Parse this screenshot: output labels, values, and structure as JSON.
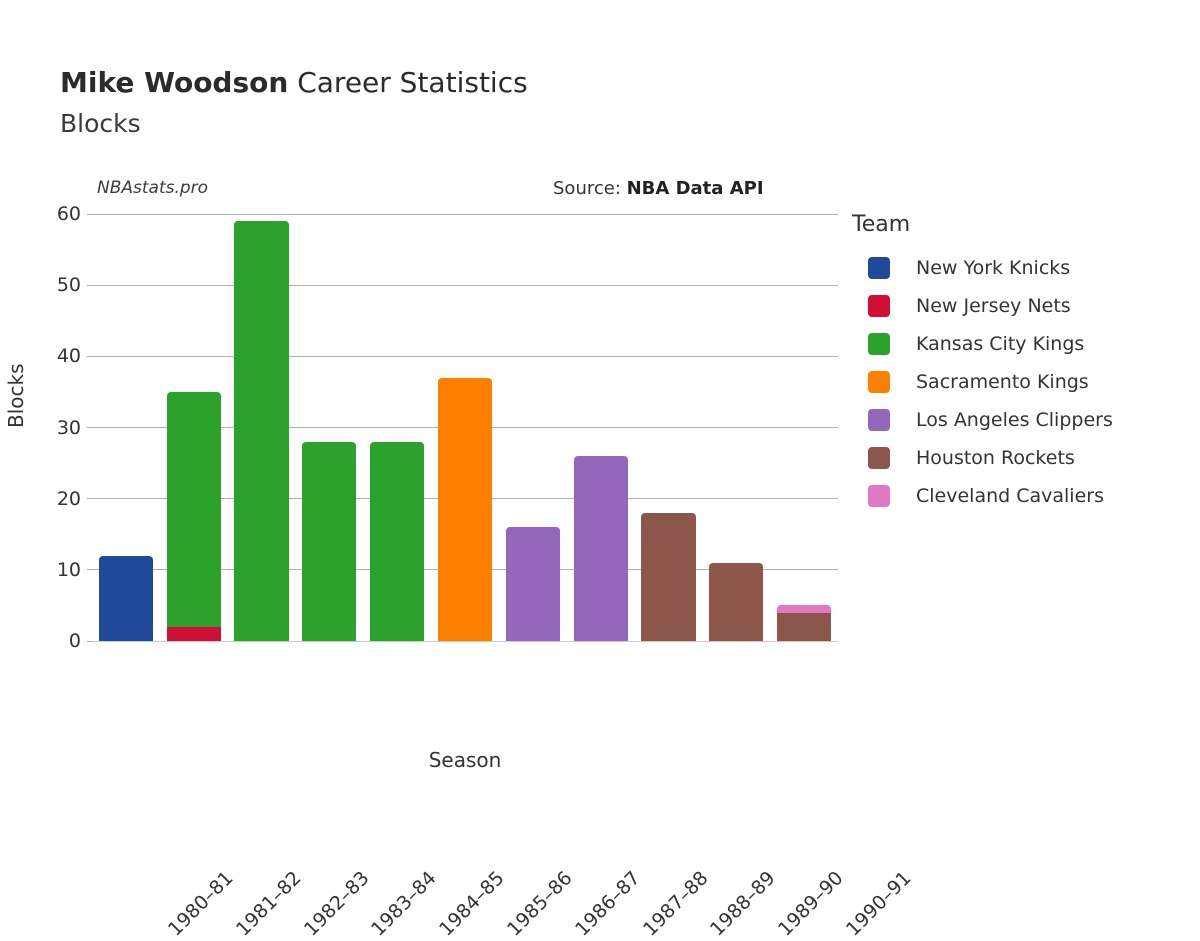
{
  "header": {
    "athlete": "Mike Woodson",
    "title_suffix": " Career Statistics",
    "subtitle": "Blocks"
  },
  "annotations": {
    "watermark": "NBAstats.pro",
    "source_label": "Source: ",
    "source_value": "NBA Data API"
  },
  "legend": {
    "title": "Team",
    "items": [
      {
        "label": "New York Knicks",
        "color": "#1f4a9b"
      },
      {
        "label": "New Jersey Nets",
        "color": "#cf1034"
      },
      {
        "label": "Kansas City Kings",
        "color": "#2ba22b"
      },
      {
        "label": "Sacramento Kings",
        "color": "#ff8000"
      },
      {
        "label": "Los Angeles Clippers",
        "color": "#9467bd"
      },
      {
        "label": "Houston Rockets",
        "color": "#8c564b"
      },
      {
        "label": "Cleveland Cavaliers",
        "color": "#e377c2"
      }
    ]
  },
  "chart_data": {
    "type": "bar",
    "title": "Mike Woodson Career Statistics",
    "subtitle": "Blocks",
    "xlabel": "Season",
    "ylabel": "Blocks",
    "ylim": [
      0,
      60
    ],
    "yticks": [
      0,
      10,
      20,
      30,
      40,
      50,
      60
    ],
    "grid": "horizontal",
    "legend_position": "right",
    "stacked": true,
    "categories": [
      "1980–81",
      "1981–82",
      "1982–83",
      "1983–84",
      "1984–85",
      "1985–86",
      "1986–87",
      "1987–88",
      "1988–89",
      "1989–90",
      "1990–91"
    ],
    "series": [
      {
        "name": "New York Knicks",
        "color": "#1f4a9b",
        "values": [
          12,
          0,
          0,
          0,
          0,
          0,
          0,
          0,
          0,
          0,
          0
        ]
      },
      {
        "name": "New Jersey Nets",
        "color": "#cf1034",
        "values": [
          0,
          2,
          0,
          0,
          0,
          0,
          0,
          0,
          0,
          0,
          0
        ]
      },
      {
        "name": "Kansas City Kings",
        "color": "#2ba22b",
        "values": [
          0,
          33,
          59,
          28,
          28,
          0,
          0,
          0,
          0,
          0,
          0
        ]
      },
      {
        "name": "Sacramento Kings",
        "color": "#ff8000",
        "values": [
          0,
          0,
          0,
          0,
          0,
          37,
          0,
          0,
          0,
          0,
          0
        ]
      },
      {
        "name": "Los Angeles Clippers",
        "color": "#9467bd",
        "values": [
          0,
          0,
          0,
          0,
          0,
          0,
          16,
          26,
          0,
          0,
          0
        ]
      },
      {
        "name": "Houston Rockets",
        "color": "#8c564b",
        "values": [
          0,
          0,
          0,
          0,
          0,
          0,
          0,
          0,
          18,
          11,
          4
        ]
      },
      {
        "name": "Cleveland Cavaliers",
        "color": "#e377c2",
        "values": [
          0,
          0,
          0,
          0,
          0,
          0,
          0,
          0,
          0,
          0,
          1
        ]
      }
    ],
    "totals": [
      12,
      35,
      59,
      28,
      28,
      37,
      16,
      26,
      18,
      11,
      5
    ]
  }
}
